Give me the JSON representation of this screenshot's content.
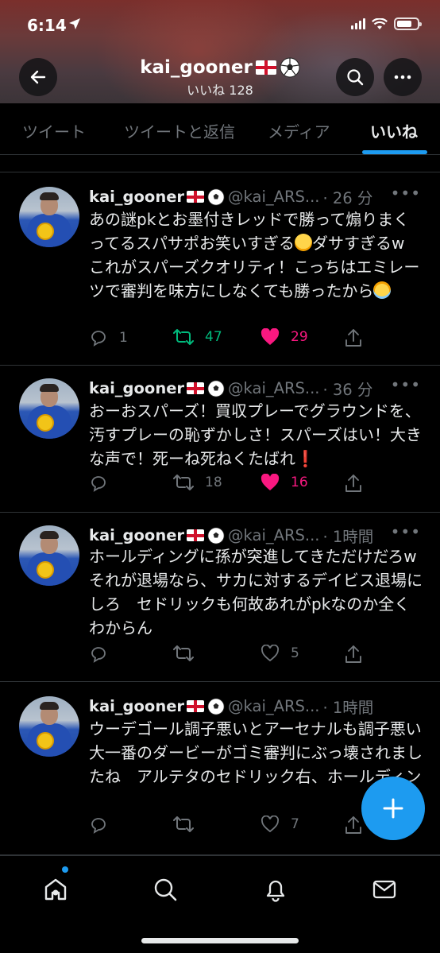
{
  "status_bar": {
    "time": "6:14"
  },
  "header": {
    "username": "kai_gooner",
    "subtitle": "いいね 128",
    "icons": [
      "back-arrow-icon",
      "search-icon",
      "more-icon"
    ]
  },
  "tabs": [
    {
      "label": "ツイート",
      "active": false
    },
    {
      "label": "ツイートと返信",
      "active": false
    },
    {
      "label": "メディア",
      "active": false
    },
    {
      "label": "いいね",
      "active": true
    }
  ],
  "tweets": [
    {
      "name": "kai_gooner",
      "handle": "@kai_ARS...",
      "time": "· 26 分",
      "text_1": "あの謎pkとお墨付きレッドで勝って煽りまくってるスパサポお笑いすぎる",
      "text_2": "ダサすぎるw これがスパーズクオリティ！こっちはエミレーツで審判を味方にしなくても勝ったから",
      "replies": "1",
      "retweets": "47",
      "likes": "29",
      "retweeted": true,
      "liked": true
    },
    {
      "name": "kai_gooner",
      "handle": "@kai_ARS...",
      "time": "· 36 分",
      "text_1": "おーおスパーズ！買収プレーでグラウンドを、汚すプレーの恥ずかしさ！スパーズはい！大きな声で！死ーね死ねくたばれ",
      "replies": "",
      "retweets": "18",
      "likes": "16",
      "retweeted": false,
      "liked": true
    },
    {
      "name": "kai_gooner",
      "handle": "@kai_ARS...",
      "time": "· 1時間",
      "text_1": "ホールディングに孫が突進してきただけだろw それが退場なら、サカに対するデイビス退場にしろ　セドリックも何故あれがpkなのか全くわからん",
      "replies": "",
      "retweets": "",
      "likes": "5",
      "retweeted": false,
      "liked": false
    },
    {
      "name": "kai_gooner",
      "handle": "@kai_ARS...",
      "time": "· 1時間",
      "text_1": "ウーデゴール調子悪いとアーセナルも調子悪い　大一番のダービーがゴミ審判にぶっ壊されましたね　アルテタのセドリック右、ホールディングの孫マンマークは大采配ミス",
      "replies": "",
      "retweets": "",
      "likes": "7",
      "retweeted": false,
      "liked": false
    }
  ],
  "bottom_nav": [
    "home-icon",
    "search-icon",
    "notifications-icon",
    "messages-icon"
  ],
  "colors": {
    "accent": "#1d9bf0",
    "like": "#f91880",
    "retweet": "#00ba7c",
    "muted": "#71767b"
  }
}
